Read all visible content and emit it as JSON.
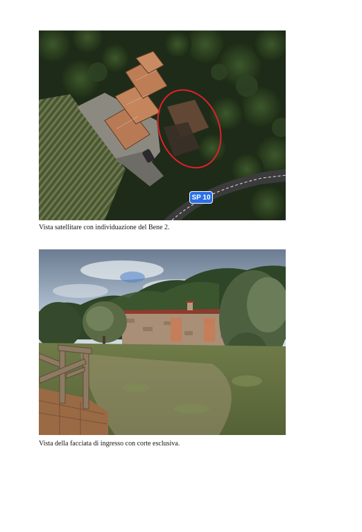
{
  "page": {
    "background": "#ffffff"
  },
  "figures": [
    {
      "kind": "satellite-map",
      "road_label": "SP 10",
      "highlight_color": "#e0202a",
      "caption": "Vista satellitare con individuazione del Bene 2."
    },
    {
      "kind": "photo",
      "caption": "Vista della facciata di ingresso con corte esclusiva."
    }
  ]
}
